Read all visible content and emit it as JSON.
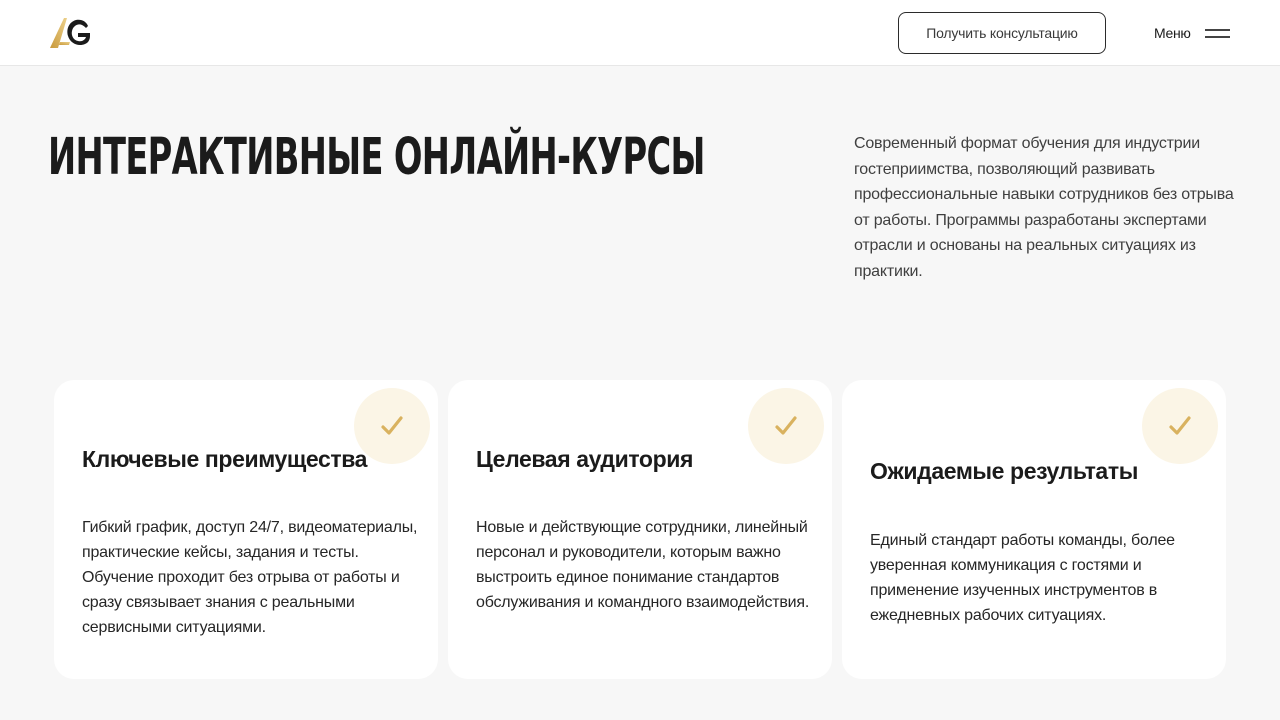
{
  "header": {
    "logo_icon": "ag-logo-icon",
    "consult_button": "Получить консультацию",
    "menu_label": "Меню",
    "menu_icon": "hamburger-icon"
  },
  "hero": {
    "title": "ИНТЕРАКТИВНЫЕ ОНЛАЙН-КУРСЫ",
    "description": "Современный формат обучения для индустрии гостеприимства, позволяющий развивать профессиональные навыки сотрудников без отрыва от работы. Программы разработаны экспертами отрасли и основаны на реальных ситуациях из практики."
  },
  "cards": [
    {
      "icon": "check-icon",
      "title": "Ключевые преимущества",
      "text": "Гибкий график, доступ 24/7, видеоматериалы, практические кейсы, задания и тесты. Обучение проходит без отрыва от работы и сразу связывает знания с реальными сервисными ситуациями."
    },
    {
      "icon": "check-icon",
      "title": "Целевая аудитория",
      "text": "Новые и действующие сотрудники, линейный персонал и руководители, которым важно выстроить единое понимание стандартов обслуживания и командного взаимодействия."
    },
    {
      "icon": "check-icon",
      "title": "Ожидаемые результаты",
      "text": "Единый стандарт работы команды, более уверенная коммуникация с гостями и применение изученных инструментов в ежедневных рабочих ситуациях."
    }
  ],
  "colors": {
    "background": "#f7f7f7",
    "card": "#ffffff",
    "accent_gold": "#d9b25f",
    "badge_bg": "#fbf5e6",
    "text": "#1b1b1b"
  }
}
